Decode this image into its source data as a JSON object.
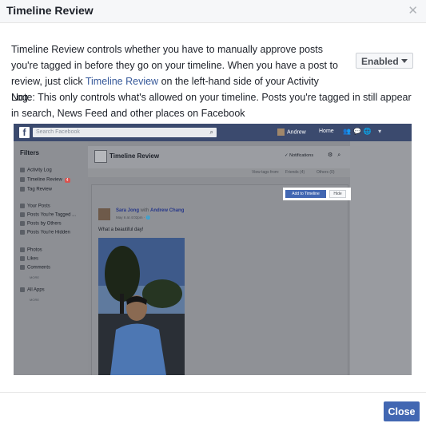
{
  "dialog": {
    "title": "Timeline Review",
    "close_icon": "close-icon"
  },
  "body": {
    "paragraph1_before_link": "Timeline Review controls whether you have to manually approve posts you're tagged in before they go on your timeline. When you have a post to review, just click ",
    "paragraph1_link": "Timeline Review",
    "paragraph1_after_link": " on the left-hand side of your Activity Log.",
    "paragraph2": "Note: This only controls what's allowed on your timeline. Posts you're tagged in still appear in search, News Feed and other places on Facebook"
  },
  "enabled_dropdown": {
    "label": "Enabled",
    "icon": "caret-down-icon"
  },
  "screenshot": {
    "search_placeholder": "Search Facebook",
    "user_name": "Andrew",
    "home": "Home",
    "filters_title": "Filters",
    "left_items": [
      {
        "label": "Activity Log"
      },
      {
        "label": "Timeline Review",
        "badge": "4"
      },
      {
        "label": "Tag Review"
      }
    ],
    "left_items2": [
      {
        "label": "Your Posts"
      },
      {
        "label": "Posts You're Tagged ..."
      },
      {
        "label": "Posts by Others"
      },
      {
        "label": "Posts You're Hidden"
      }
    ],
    "left_items3": [
      {
        "label": "Photos"
      },
      {
        "label": "Likes"
      },
      {
        "label": "Comments"
      }
    ],
    "more1": "MORE",
    "all_apps": "All Apps",
    "more2": "MORE",
    "header_title": "Timeline Review",
    "notifications": "✓ Notifications",
    "view_tags_from": "View tags from:",
    "friends": "Friends (4)",
    "others": "Others (0)",
    "add_to_timeline": "Add to Timeline",
    "hide": "Hide",
    "post_author": "Sara Jong",
    "post_with": " with ",
    "post_tagged": "Andrew Chang",
    "post_date": "May 6 at 4:02pm · 🌐",
    "post_text": "What a beautiful day!"
  },
  "footer": {
    "close_label": "Close"
  },
  "colors": {
    "accent": "#4267b2",
    "link": "#365899"
  }
}
